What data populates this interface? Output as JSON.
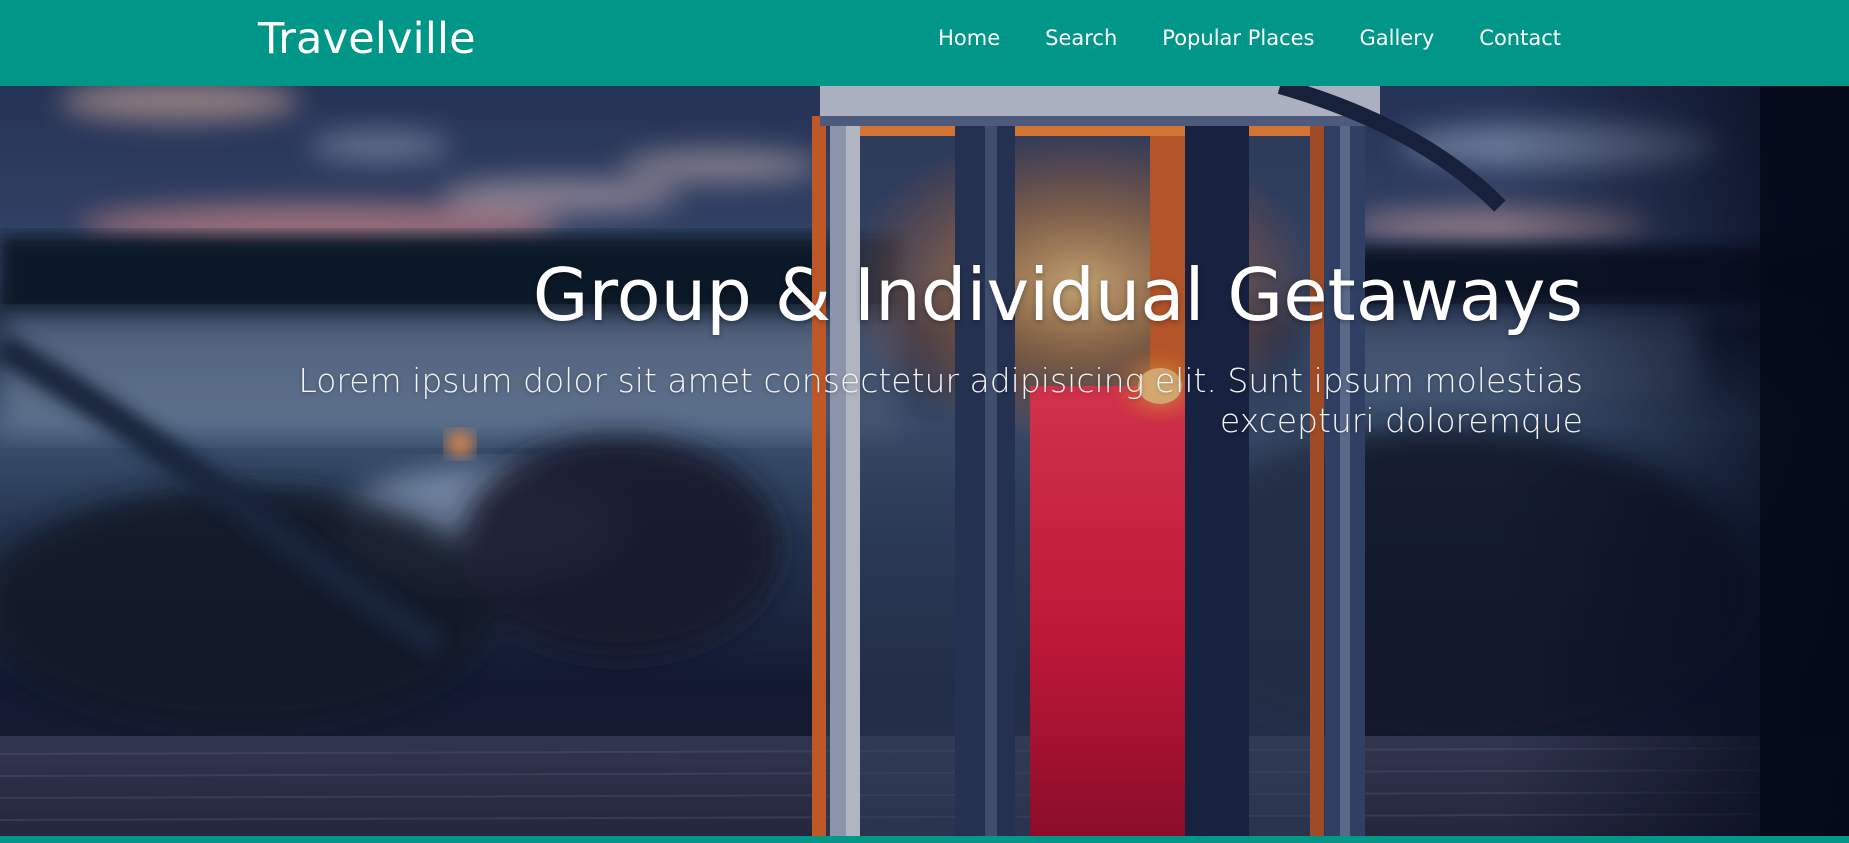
{
  "brand": {
    "name": "Travelville"
  },
  "nav": {
    "items": [
      {
        "label": "Home"
      },
      {
        "label": "Search"
      },
      {
        "label": "Popular Places"
      },
      {
        "label": "Gallery"
      },
      {
        "label": "Contact"
      }
    ]
  },
  "hero": {
    "title": "Group & Individual Getaways",
    "subtitle": "Lorem ipsum dolor sit amet consectetur adipisicing elit. Sunt ipsum molestias excepturi doloremque",
    "background": "lantern-with-candle-photo"
  },
  "colors": {
    "primary": "#009688",
    "text": "#ffffff"
  }
}
